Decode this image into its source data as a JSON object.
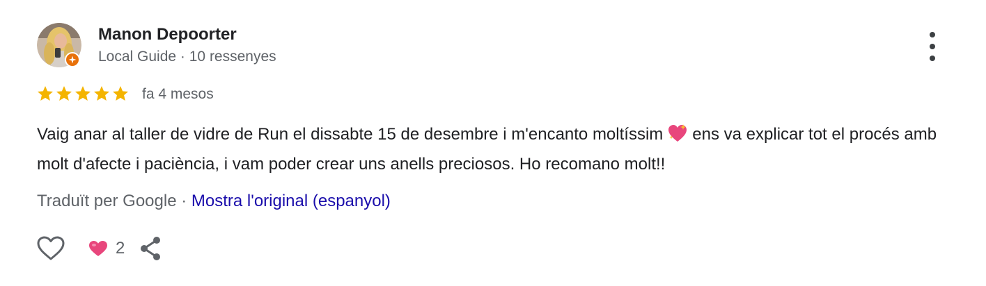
{
  "reviewer": {
    "name": "Manon Depoorter",
    "level": "Local Guide",
    "separator": " · ",
    "review_count": "10 ressenyes"
  },
  "rating": {
    "stars": 5,
    "max": 5,
    "color": "#f4b400",
    "time_ago": "fa 4 mesos"
  },
  "review": {
    "text_before_emoji": "Vaig anar al taller de vidre de Run el dissabte 15 de desembre i m'encanto moltíssim",
    "emoji": "sparkling-heart",
    "text_after_emoji": "ens va explicar tot el procés amb molt d'afecte i paciència, i vam poder crear uns anells preciosos. Ho recomano molt!!"
  },
  "translation": {
    "label": "Traduït per Google",
    "separator": " · ",
    "link": "Mostra l'original (espanyol)"
  },
  "actions": {
    "like_icon": "heart-outline-icon",
    "reaction_icon": "heart-reaction-icon",
    "reaction_count": "2",
    "share_icon": "share-icon"
  },
  "colors": {
    "name": "#202124",
    "secondary": "#5f6368",
    "link": "#1a0dab",
    "star": "#f4b400",
    "badge": "#e8710a",
    "reaction_heart": "#e8467c"
  }
}
